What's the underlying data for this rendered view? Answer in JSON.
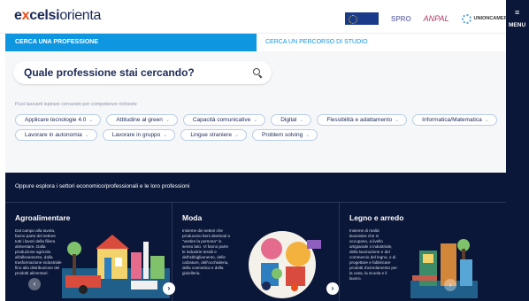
{
  "header": {
    "logo": {
      "part1": "e",
      "part2": "x",
      "part3": "celsi",
      "part4": "orienta"
    },
    "partners": {
      "spro": "SPRO",
      "anpal": "ANPAL",
      "unioncamere": "UNIONCAMERE"
    }
  },
  "menu": {
    "label": "MENU"
  },
  "tabs": [
    {
      "label": "CERCA UNA PROFESSIONE",
      "active": true
    },
    {
      "label": "CERCA UN PERCORSO DI STUDIO",
      "active": false
    }
  ],
  "search": {
    "title": "Quale professione stai cercando?",
    "hint": "Puoi lasciarti ispirare cercando per competenze richieste"
  },
  "chips_row1": [
    "Applicare tecnologie 4.0",
    "Attitudine al green",
    "Capacità comunicative",
    "Digital",
    "Flessibilità e adattamento",
    "Informatica/Matematica"
  ],
  "chips_row2": [
    "Lavorare in autonomia",
    "Lavorare in gruppo",
    "Lingue straniere",
    "Problem solving"
  ],
  "explore": {
    "title": "Oppure esplora i settori economico/professionali e le loro professioni"
  },
  "cards": [
    {
      "title": "Agroalimentare",
      "text": "Dal campo alla tavola, fanno parte del settore tutti i lavori della filiera alimentare. Dalla produzione agricola all'allevamento, dalla trasformazione industriale fino alla distribuzione dei prodotti alimentari."
    },
    {
      "title": "Moda",
      "text": "Insieme dei settori che producono beni destinati a \"vestire la persona\" in senso lato. Vi fanno parte le industrie tessili e dell'abbigliamento, delle calzature, dell'occhialeria, della cosmetica e della gioielleria."
    },
    {
      "title": "Legno e arredo",
      "text": "Insieme di realtà lavorative che si occupano, a livello artigianale o industriale, della lavorazione e del commercio del legno, o di progettare e fabbricare prodotti d'arredamento per la casa, la scuola e il lavoro."
    }
  ],
  "colors": {
    "brand_navy": "#0b1738",
    "accent_blue": "#0e97e0",
    "logo_orange": "#e94e1b"
  }
}
